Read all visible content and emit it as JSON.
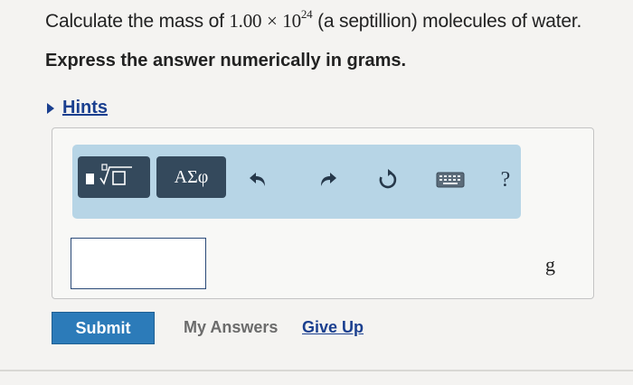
{
  "question": {
    "prefix": "Calculate the mass of ",
    "coefficient": "1.00",
    "times": "×",
    "base": "10",
    "exponent": "24",
    "suffix": " (a septillion) molecules of water."
  },
  "instruction": "Express the answer numerically in grams.",
  "hints": {
    "label": "Hints"
  },
  "toolbar": {
    "symbols_label": "ΑΣφ",
    "help_label": "?",
    "icons": [
      "templates-icon",
      "undo-icon",
      "redo-icon",
      "reset-icon",
      "keyboard-icon",
      "help-icon"
    ]
  },
  "answer": {
    "value": "",
    "unit": "g"
  },
  "actions": {
    "submit": "Submit",
    "my_answers": "My Answers",
    "give_up": "Give Up"
  },
  "colors": {
    "toolbar_bg": "#b7d5e6",
    "toolbar_button": "#34495c",
    "submit_bg": "#2c7bb9",
    "link": "#1a3f8f"
  }
}
